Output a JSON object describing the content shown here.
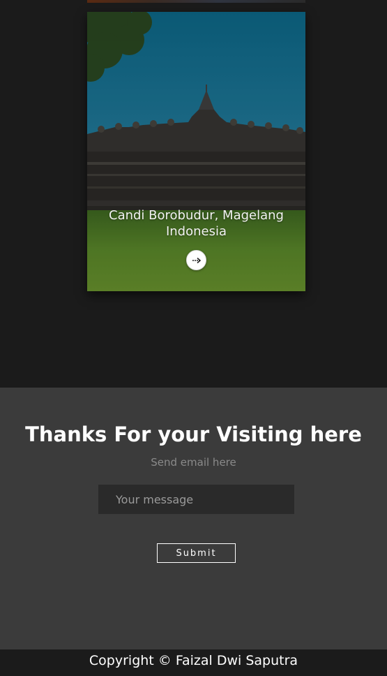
{
  "card": {
    "title_line1": "Candi Borobudur, Magelang",
    "title_line2": "Indonesia",
    "arrow_icon": "arrow-right-icon"
  },
  "contact": {
    "title": "Thanks For your Visiting here",
    "subtitle": "Send email here",
    "message_placeholder": "Your message",
    "message_value": "",
    "submit_label": "Submit"
  },
  "footer": {
    "copyright": "Copyright © Faizal Dwi Saputra"
  },
  "colors": {
    "page_bg": "#1b1b1b",
    "contact_bg": "#3b3b3b",
    "input_bg": "#2a2a2a",
    "text_light": "#ffffff",
    "text_muted": "#8a8a8a"
  }
}
